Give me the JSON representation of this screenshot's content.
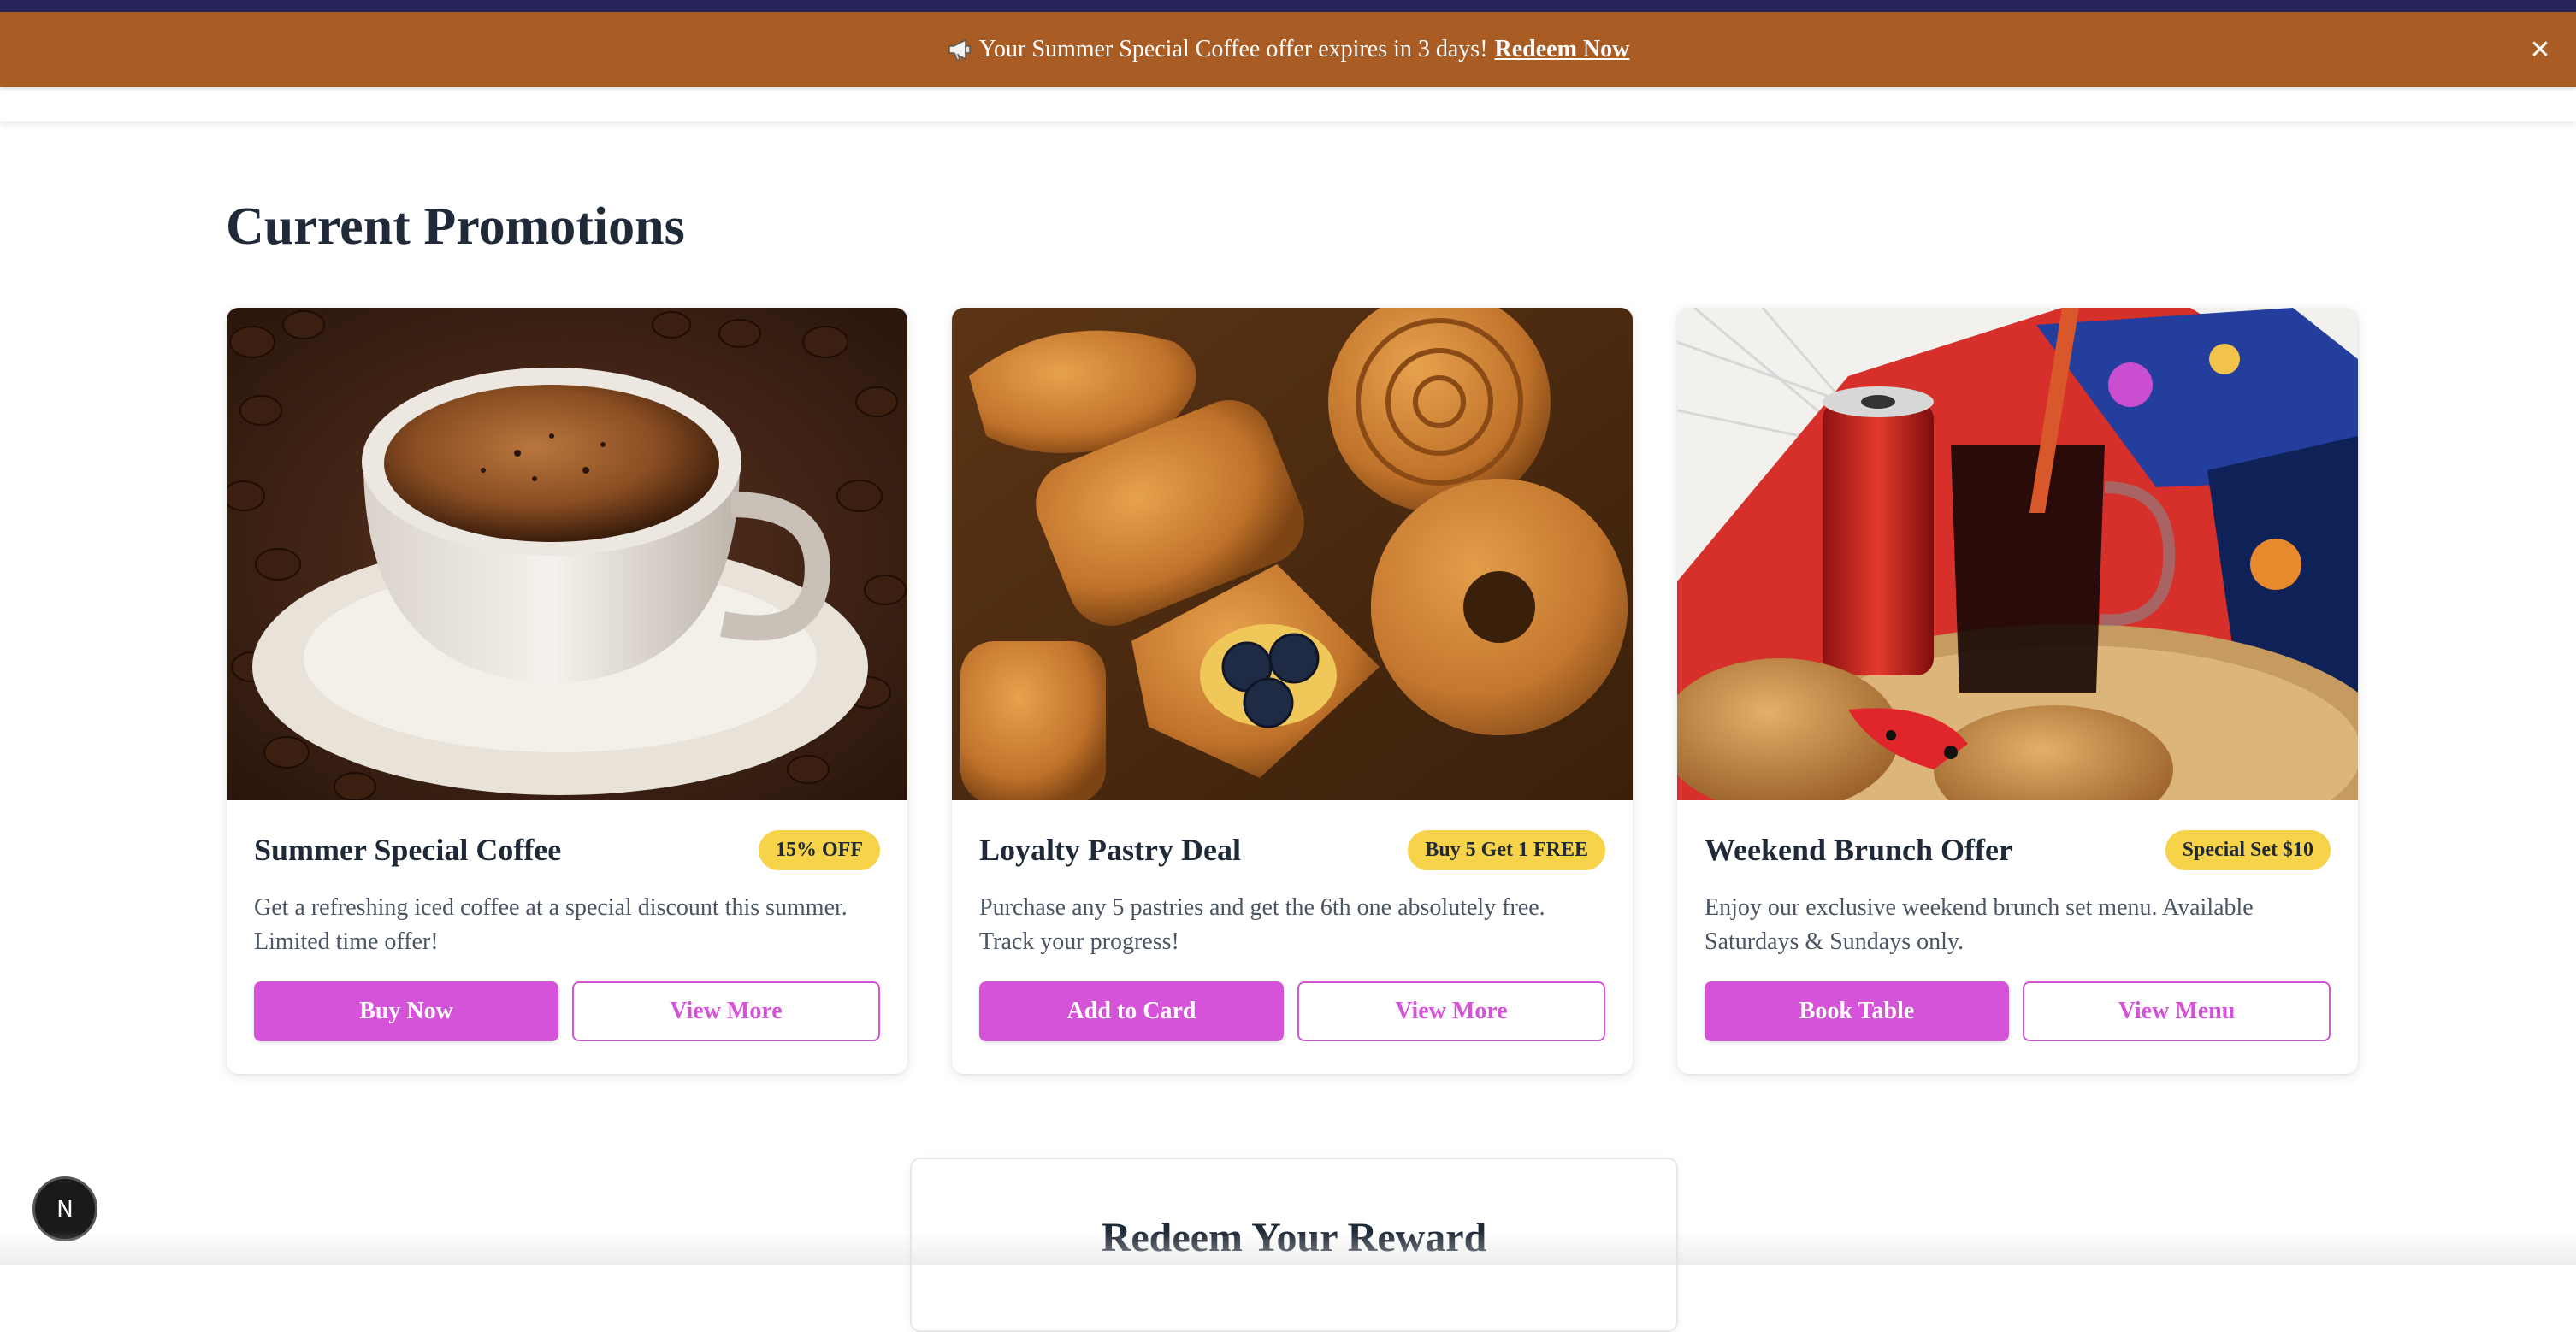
{
  "banner": {
    "icon": "megaphone-icon",
    "message": "Your Summer Special Coffee offer expires in 3 days!",
    "link": "Redeem Now",
    "close": "✕",
    "background": "#a95d25"
  },
  "section": {
    "title": "Current Promotions"
  },
  "promotions": [
    {
      "title": "Summer Special Coffee",
      "badge": "15% OFF",
      "description": "Get a refreshing iced coffee at a special discount this summer. Limited time offer!",
      "primary": "Buy Now",
      "secondary": "View More",
      "image": "coffee-cup-on-beans"
    },
    {
      "title": "Loyalty Pastry Deal",
      "badge": "Buy 5 Get 1 FREE",
      "description": "Purchase any 5 pastries and get the 6th one absolutely free. Track your progress!",
      "primary": "Add to Card",
      "secondary": "View More",
      "image": "assorted-pastries"
    },
    {
      "title": "Weekend Brunch Offer",
      "badge": "Special Set $10",
      "description": "Enjoy our exclusive weekend brunch set menu. Available Saturdays & Sundays only.",
      "primary": "Book Table",
      "secondary": "View Menu",
      "image": "brunch-drinks-and-buns"
    }
  ],
  "redeem": {
    "title": "Redeem Your Reward"
  },
  "dev_badge": {
    "label": "N"
  },
  "colors": {
    "accent": "#d553d8",
    "badge": "#f7d34a",
    "text": "#1f2937"
  }
}
